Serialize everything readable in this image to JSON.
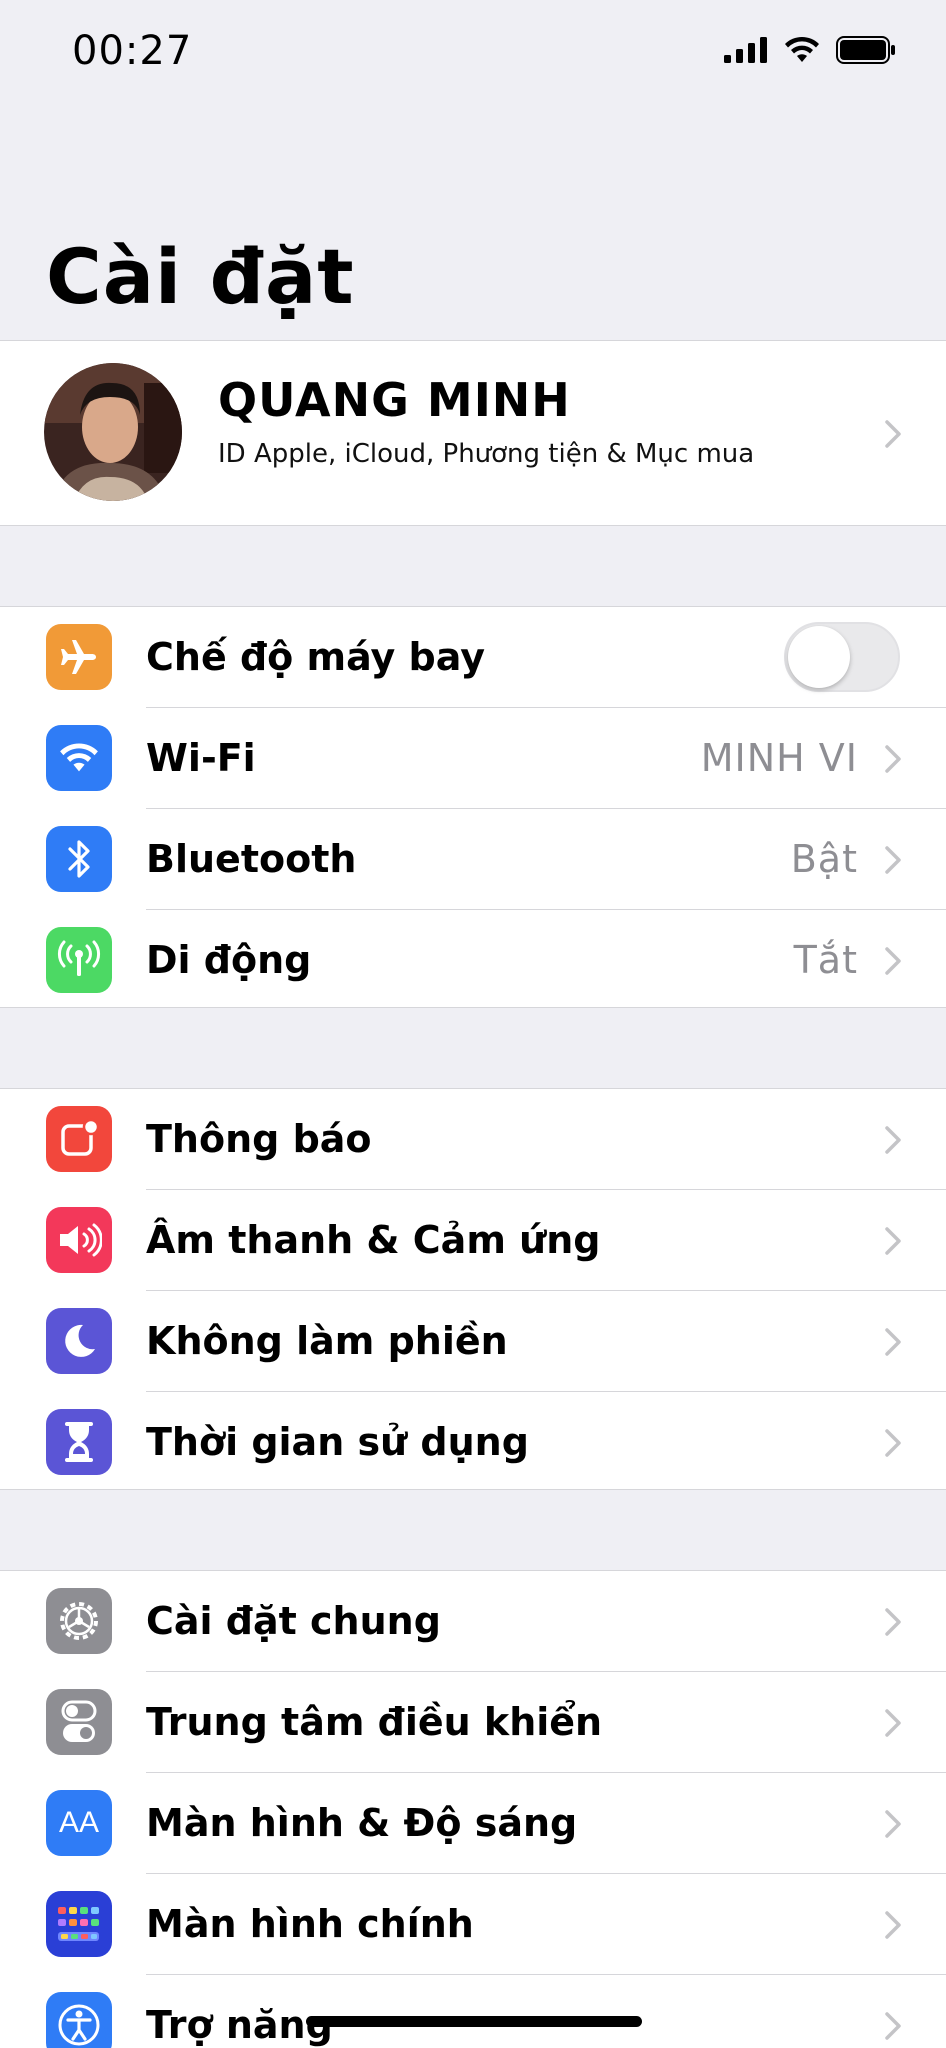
{
  "status_bar": {
    "time": "00:27"
  },
  "title": "Cài đặt",
  "profile": {
    "name": "QUANG MINH",
    "subtitle": "ID Apple, iCloud, Phương tiện & Mục mua"
  },
  "colors": {
    "orange": "#f19a37",
    "blue": "#2f7cf6",
    "green": "#4cd964",
    "red": "#f2473c",
    "pink": "#f3385a",
    "indigo": "#5b55d6",
    "gray": "#8e8e93"
  },
  "group1": [
    {
      "label": "Chế độ máy bay",
      "icon": "airplane-icon",
      "toggle_on": false
    },
    {
      "label": "Wi-Fi",
      "icon": "wifi-icon",
      "value": "MINH VI"
    },
    {
      "label": "Bluetooth",
      "icon": "bluetooth-icon",
      "value": "Bật"
    },
    {
      "label": "Di động",
      "icon": "cellular-icon",
      "value": "Tắt"
    }
  ],
  "group2": [
    {
      "label": "Thông báo",
      "icon": "notifications-icon"
    },
    {
      "label": "Âm thanh & Cảm ứng",
      "icon": "sound-icon"
    },
    {
      "label": "Không làm phiền",
      "icon": "moon-icon"
    },
    {
      "label": "Thời gian sử dụng",
      "icon": "hourglass-icon"
    }
  ],
  "group3": [
    {
      "label": "Cài đặt chung",
      "icon": "gear-icon"
    },
    {
      "label": "Trung tâm điều khiển",
      "icon": "control-center-icon"
    },
    {
      "label": "Màn hình & Độ sáng",
      "icon": "display-icon",
      "icon_text": "AA"
    },
    {
      "label": "Màn hình chính",
      "icon": "home-screen-icon"
    },
    {
      "label": "Trợ năng",
      "icon": "accessibility-icon"
    }
  ]
}
